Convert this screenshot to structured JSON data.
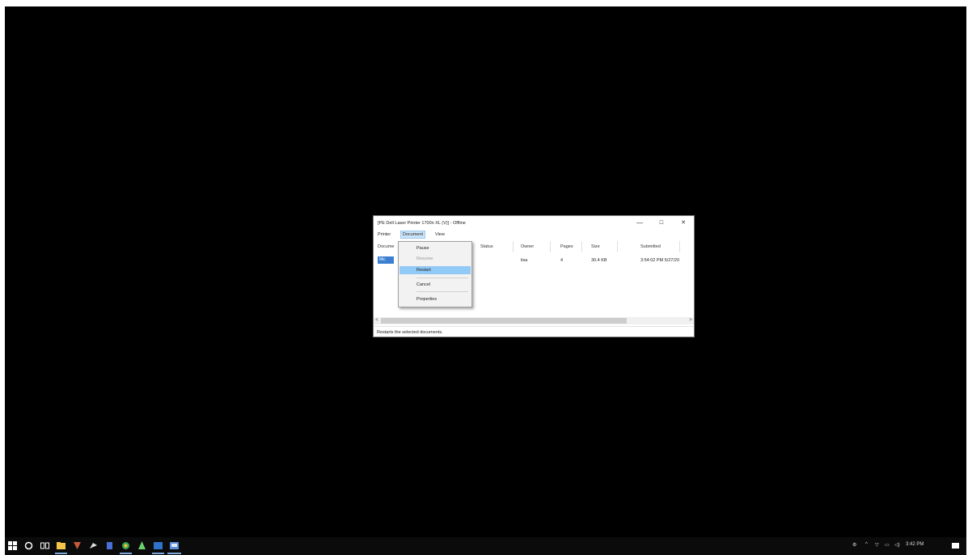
{
  "window": {
    "title": "[PE Dell Laser Printer 1700n XL (V)] - Offline",
    "minimize": "—",
    "maximize": "☐",
    "close": "✕"
  },
  "menu": {
    "printer": "Printer",
    "document": "Document",
    "view": "View"
  },
  "columns": [
    "Docume",
    "Status",
    "Owner",
    "Pages",
    "Size",
    "Submitted"
  ],
  "row": {
    "document": "Mic",
    "status": "",
    "owner": "lisa",
    "pages": "4",
    "size": "30.4 KB",
    "submitted": "3:54:02 PM 5/27/20"
  },
  "dropdown": {
    "pause": "Pause",
    "resume": "Resume",
    "restart": "Restart",
    "cancel": "Cancel",
    "properties": "Properties"
  },
  "status_text": "Restarts the selected documents.",
  "scroll": {
    "left": "<",
    "right": ">"
  },
  "tray": {
    "time": "3:42 PM"
  },
  "colors": {
    "accent": "#91c9f7",
    "selection": "#3a7fd0",
    "desktop": "#000000"
  }
}
